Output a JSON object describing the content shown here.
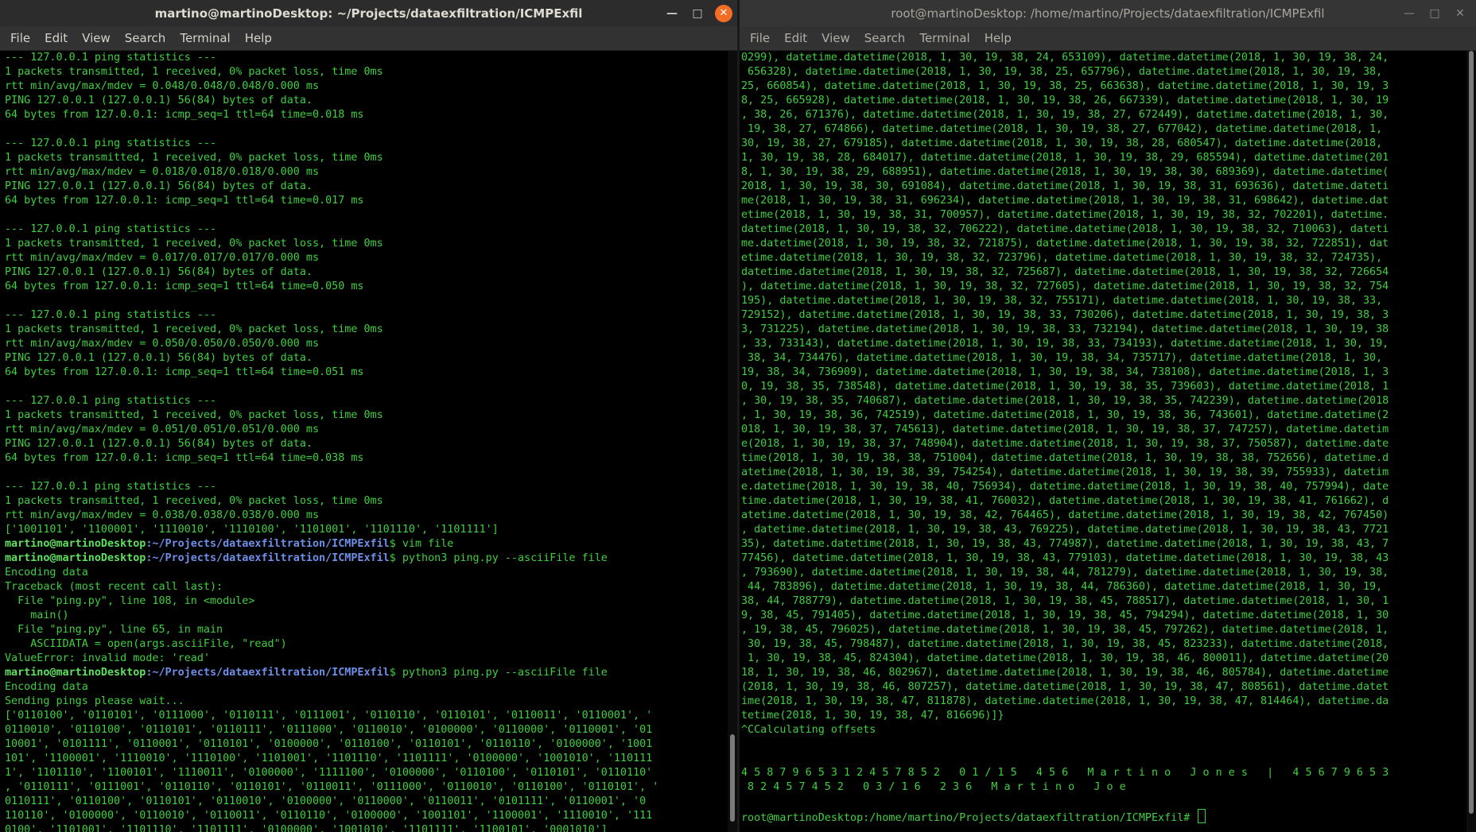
{
  "left": {
    "title": "martino@martinoDesktop: ~/Projects/dataexfiltration/ICMPExfil",
    "menu": [
      "File",
      "Edit",
      "View",
      "Search",
      "Terminal",
      "Help"
    ],
    "lines": [
      "--- 127.0.0.1 ping statistics ---",
      "1 packets transmitted, 1 received, 0% packet loss, time 0ms",
      "rtt min/avg/max/mdev = 0.048/0.048/0.048/0.000 ms",
      "PING 127.0.0.1 (127.0.0.1) 56(84) bytes of data.",
      "64 bytes from 127.0.0.1: icmp_seq=1 ttl=64 time=0.018 ms",
      "",
      "--- 127.0.0.1 ping statistics ---",
      "1 packets transmitted, 1 received, 0% packet loss, time 0ms",
      "rtt min/avg/max/mdev = 0.018/0.018/0.018/0.000 ms",
      "PING 127.0.0.1 (127.0.0.1) 56(84) bytes of data.",
      "64 bytes from 127.0.0.1: icmp_seq=1 ttl=64 time=0.017 ms",
      "",
      "--- 127.0.0.1 ping statistics ---",
      "1 packets transmitted, 1 received, 0% packet loss, time 0ms",
      "rtt min/avg/max/mdev = 0.017/0.017/0.017/0.000 ms",
      "PING 127.0.0.1 (127.0.0.1) 56(84) bytes of data.",
      "64 bytes from 127.0.0.1: icmp_seq=1 ttl=64 time=0.050 ms",
      "",
      "--- 127.0.0.1 ping statistics ---",
      "1 packets transmitted, 1 received, 0% packet loss, time 0ms",
      "rtt min/avg/max/mdev = 0.050/0.050/0.050/0.000 ms",
      "PING 127.0.0.1 (127.0.0.1) 56(84) bytes of data.",
      "64 bytes from 127.0.0.1: icmp_seq=1 ttl=64 time=0.051 ms",
      "",
      "--- 127.0.0.1 ping statistics ---",
      "1 packets transmitted, 1 received, 0% packet loss, time 0ms",
      "rtt min/avg/max/mdev = 0.051/0.051/0.051/0.000 ms",
      "PING 127.0.0.1 (127.0.0.1) 56(84) bytes of data.",
      "64 bytes from 127.0.0.1: icmp_seq=1 ttl=64 time=0.038 ms",
      "",
      "--- 127.0.0.1 ping statistics ---",
      "1 packets transmitted, 1 received, 0% packet loss, time 0ms",
      "rtt min/avg/max/mdev = 0.038/0.038/0.038/0.000 ms",
      "['1001101', '1100001', '1110010', '1110100', '1101001', '1101110', '1101111']",
      {
        "user": "martino@martinoDesktop",
        "path": ":~/Projects/dataexfiltration/ICMPExfil",
        "cmd": "$ vim file"
      },
      {
        "user": "martino@martinoDesktop",
        "path": ":~/Projects/dataexfiltration/ICMPExfil",
        "cmd": "$ python3 ping.py --asciiFile file"
      },
      "Encoding data",
      "Traceback (most recent call last):",
      "  File \"ping.py\", line 108, in <module>",
      "    main()",
      "  File \"ping.py\", line 65, in main",
      "    ASCIIDATA = open(args.asciiFile, \"read\")",
      "ValueError: invalid mode: 'read'",
      {
        "user": "martino@martinoDesktop",
        "path": ":~/Projects/dataexfiltration/ICMPExfil",
        "cmd": "$ python3 ping.py --asciiFile file"
      },
      "Encoding data",
      "Sending pings please wait...",
      "['0110100', '0110101', '0111000', '0110111', '0111001', '0110110', '0110101', '0110011', '0110001', '",
      "0110010', '0110100', '0110101', '0110111', '0111000', '0110010', '0100000', '0110000', '0110001', '01",
      "10001', '0101111', '0110001', '0110101', '0100000', '0110100', '0110101', '0110110', '0100000', '1001",
      "101', '1100001', '1110010', '1110100', '1101001', '1101110', '1101111', '0100000', '1001010', '110111",
      "1', '1101110', '1100101', '1110011', '0100000', '1111100', '0100000', '0110100', '0110101', '0110110'",
      ", '0110111', '0111001', '0110110', '0110101', '0110011', '0111000', '0110010', '0110100', '0110101', '",
      "0110111', '0110100', '0110101', '0110010', '0100000', '0110000', '0110011', '0101111', '0110001', '0",
      "110110', '0100000', '0110010', '0110011', '0110110', '0100000', '1001101', '1100001', '1110010', '111",
      "0100', '1101001', '1101110', '1101111', '0100000', '1001010', '1101111', '1100101', '0001010']"
    ]
  },
  "right": {
    "title": "root@martinoDesktop: /home/martino/Projects/dataexfiltration/ICMPExfil",
    "menu": [
      "File",
      "Edit",
      "View",
      "Search",
      "Terminal",
      "Help"
    ],
    "lines": [
      "0299), datetime.datetime(2018, 1, 30, 19, 38, 24, 653109), datetime.datetime(2018, 1, 30, 19, 38, 24,",
      " 656328), datetime.datetime(2018, 1, 30, 19, 38, 25, 657796), datetime.datetime(2018, 1, 30, 19, 38,",
      "25, 660854), datetime.datetime(2018, 1, 30, 19, 38, 25, 663638), datetime.datetime(2018, 1, 30, 19, 3",
      "8, 25, 665928), datetime.datetime(2018, 1, 30, 19, 38, 26, 667339), datetime.datetime(2018, 1, 30, 19",
      ", 38, 26, 671376), datetime.datetime(2018, 1, 30, 19, 38, 27, 672449), datetime.datetime(2018, 1, 30,",
      " 19, 38, 27, 674866), datetime.datetime(2018, 1, 30, 19, 38, 27, 677042), datetime.datetime(2018, 1,",
      "30, 19, 38, 27, 679185), datetime.datetime(2018, 1, 30, 19, 38, 28, 680547), datetime.datetime(2018,",
      "1, 30, 19, 38, 28, 684017), datetime.datetime(2018, 1, 30, 19, 38, 29, 685594), datetime.datetime(201",
      "8, 1, 30, 19, 38, 29, 688951), datetime.datetime(2018, 1, 30, 19, 38, 30, 689369), datetime.datetime(",
      "2018, 1, 30, 19, 38, 30, 691084), datetime.datetime(2018, 1, 30, 19, 38, 31, 693636), datetime.dateti",
      "me(2018, 1, 30, 19, 38, 31, 696234), datetime.datetime(2018, 1, 30, 19, 38, 31, 698642), datetime.dat",
      "etime(2018, 1, 30, 19, 38, 31, 700957), datetime.datetime(2018, 1, 30, 19, 38, 32, 702201), datetime.",
      "datetime(2018, 1, 30, 19, 38, 32, 706222), datetime.datetime(2018, 1, 30, 19, 38, 32, 710063), dateti",
      "me.datetime(2018, 1, 30, 19, 38, 32, 721875), datetime.datetime(2018, 1, 30, 19, 38, 32, 722851), dat",
      "etime.datetime(2018, 1, 30, 19, 38, 32, 723796), datetime.datetime(2018, 1, 30, 19, 38, 32, 724735),",
      "datetime.datetime(2018, 1, 30, 19, 38, 32, 725687), datetime.datetime(2018, 1, 30, 19, 38, 32, 726654",
      "), datetime.datetime(2018, 1, 30, 19, 38, 32, 727605), datetime.datetime(2018, 1, 30, 19, 38, 32, 754",
      "195), datetime.datetime(2018, 1, 30, 19, 38, 32, 755171), datetime.datetime(2018, 1, 30, 19, 38, 33,",
      "729152), datetime.datetime(2018, 1, 30, 19, 38, 33, 730206), datetime.datetime(2018, 1, 30, 19, 38, 3",
      "3, 731225), datetime.datetime(2018, 1, 30, 19, 38, 33, 732194), datetime.datetime(2018, 1, 30, 19, 38",
      ", 33, 733143), datetime.datetime(2018, 1, 30, 19, 38, 33, 734193), datetime.datetime(2018, 1, 30, 19,",
      " 38, 34, 734476), datetime.datetime(2018, 1, 30, 19, 38, 34, 735717), datetime.datetime(2018, 1, 30,",
      "19, 38, 34, 736909), datetime.datetime(2018, 1, 30, 19, 38, 34, 738108), datetime.datetime(2018, 1, 3",
      "0, 19, 38, 35, 738548), datetime.datetime(2018, 1, 30, 19, 38, 35, 739603), datetime.datetime(2018, 1",
      ", 30, 19, 38, 35, 740687), datetime.datetime(2018, 1, 30, 19, 38, 35, 742239), datetime.datetime(2018",
      ", 1, 30, 19, 38, 36, 742519), datetime.datetime(2018, 1, 30, 19, 38, 36, 743601), datetime.datetime(2",
      "018, 1, 30, 19, 38, 37, 745613), datetime.datetime(2018, 1, 30, 19, 38, 37, 747257), datetime.datetim",
      "e(2018, 1, 30, 19, 38, 37, 748904), datetime.datetime(2018, 1, 30, 19, 38, 37, 750587), datetime.date",
      "time(2018, 1, 30, 19, 38, 38, 751004), datetime.datetime(2018, 1, 30, 19, 38, 38, 752656), datetime.d",
      "atetime(2018, 1, 30, 19, 38, 39, 754254), datetime.datetime(2018, 1, 30, 19, 38, 39, 755933), datetim",
      "e.datetime(2018, 1, 30, 19, 38, 40, 756934), datetime.datetime(2018, 1, 30, 19, 38, 40, 757994), date",
      "time.datetime(2018, 1, 30, 19, 38, 41, 760032), datetime.datetime(2018, 1, 30, 19, 38, 41, 761662), d",
      "atetime.datetime(2018, 1, 30, 19, 38, 42, 764465), datetime.datetime(2018, 1, 30, 19, 38, 42, 767450)",
      ", datetime.datetime(2018, 1, 30, 19, 38, 43, 769225), datetime.datetime(2018, 1, 30, 19, 38, 43, 7721",
      "35), datetime.datetime(2018, 1, 30, 19, 38, 43, 774987), datetime.datetime(2018, 1, 30, 19, 38, 43, 7",
      "77456), datetime.datetime(2018, 1, 30, 19, 38, 43, 779103), datetime.datetime(2018, 1, 30, 19, 38, 43",
      ", 793690), datetime.datetime(2018, 1, 30, 19, 38, 44, 781279), datetime.datetime(2018, 1, 30, 19, 38,",
      " 44, 783896), datetime.datetime(2018, 1, 30, 19, 38, 44, 786360), datetime.datetime(2018, 1, 30, 19,",
      "38, 44, 788779), datetime.datetime(2018, 1, 30, 19, 38, 45, 788517), datetime.datetime(2018, 1, 30, 1",
      "9, 38, 45, 791405), datetime.datetime(2018, 1, 30, 19, 38, 45, 794294), datetime.datetime(2018, 1, 30",
      ", 19, 38, 45, 796025), datetime.datetime(2018, 1, 30, 19, 38, 45, 797262), datetime.datetime(2018, 1,",
      " 30, 19, 38, 45, 798487), datetime.datetime(2018, 1, 30, 19, 38, 45, 823233), datetime.datetime(2018,",
      " 1, 30, 19, 38, 45, 824304), datetime.datetime(2018, 1, 30, 19, 38, 46, 800011), datetime.datetime(20",
      "18, 1, 30, 19, 38, 46, 802967), datetime.datetime(2018, 1, 30, 19, 38, 46, 805784), datetime.datetime",
      "(2018, 1, 30, 19, 38, 46, 807257), datetime.datetime(2018, 1, 30, 19, 38, 47, 808561), datetime.datet",
      "ime(2018, 1, 30, 19, 38, 47, 811878), datetime.datetime(2018, 1, 30, 19, 38, 47, 814464), datetime.da",
      "tetime(2018, 1, 30, 19, 38, 47, 816696)]}",
      "^CCalculating offsets",
      "",
      "",
      "4 5 8 7 9 6 5 3 1 2 4 5 7 8 5 2   0 1 / 1 5   4 5 6   M a r t i n o   J o n e s   |   4 5 6 7 9 6 5 3",
      " 8 2 4 5 7 4 5 2   0 3 / 1 6   2 3 6   M a r t i n o   J o e",
      "",
      {
        "prompt": "root@martinoDesktop:/home/martino/Projects/dataexfiltration/ICMPExfil# "
      }
    ]
  }
}
